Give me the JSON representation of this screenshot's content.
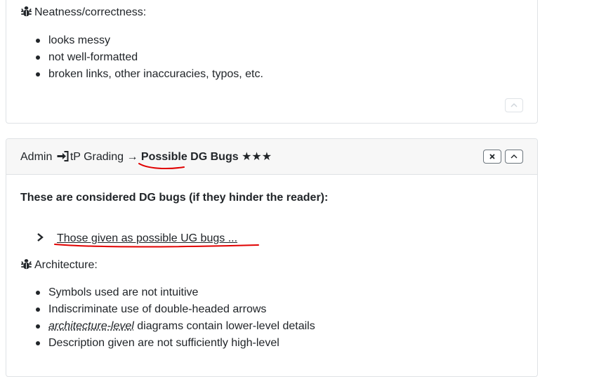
{
  "neatness_card": {
    "heading": "Neatness/correctness:",
    "items": [
      "looks messy",
      "not well-formatted",
      "broken links, other inaccuracies, typos, etc."
    ]
  },
  "dg_card": {
    "breadcrumb": {
      "admin": "Admin",
      "section": "tP Grading",
      "arrow": "→",
      "title": "Possible DG Bugs",
      "stars": "★★★"
    },
    "intro": "These are considered DG bugs (if they hinder the reader):",
    "details_summary": "Those given as possible UG bugs ...",
    "architecture_heading": "Architecture:",
    "architecture_items": [
      {
        "term": "",
        "text": "Symbols used are not intuitive"
      },
      {
        "term": "",
        "text": "Indiscriminate use of double-headed arrows"
      },
      {
        "term": "architecture-level",
        "text": " diagrams contain lower-level details"
      },
      {
        "term": "",
        "text": "Description given are not sufficiently high-level"
      }
    ]
  },
  "colors": {
    "annotation_red": "#e00000",
    "header_bg": "#f7f7f7",
    "border": "#dfe2e5"
  }
}
